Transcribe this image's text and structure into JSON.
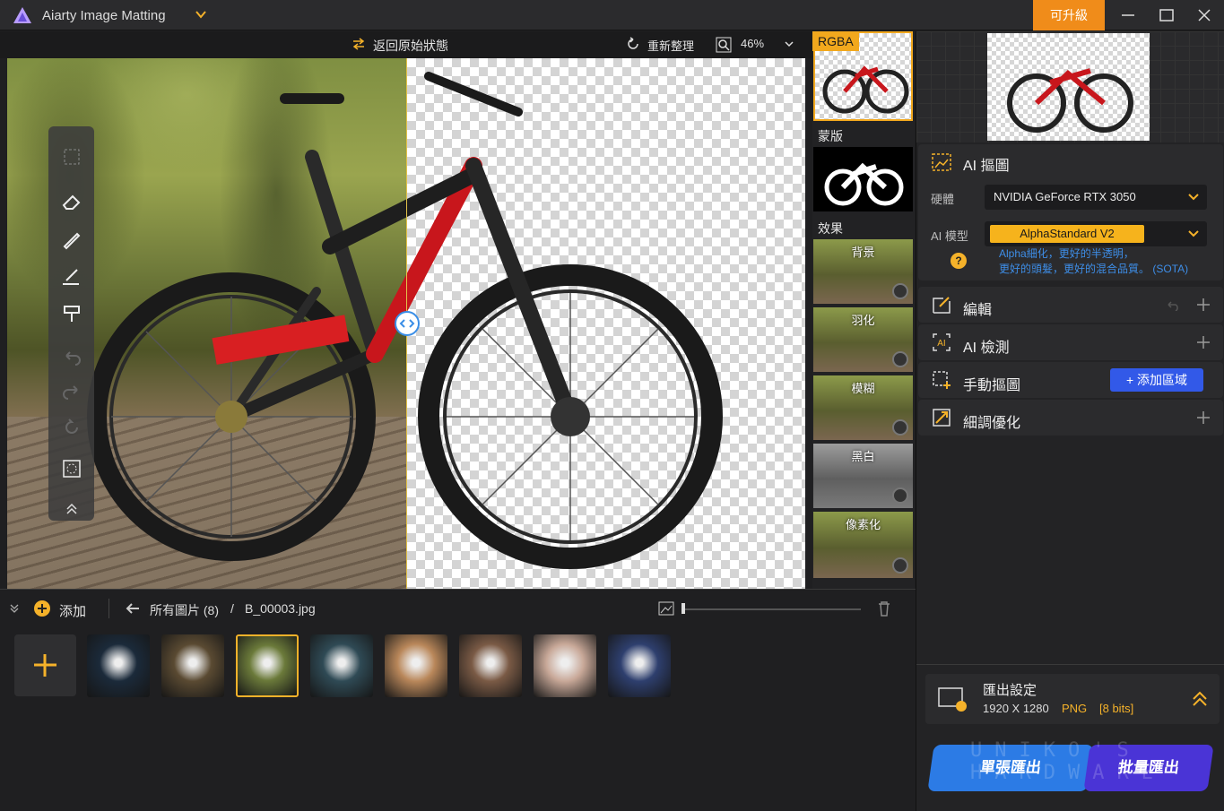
{
  "app": {
    "title": "Aiarty Image Matting",
    "upgrade_label": "可升級"
  },
  "canvas_toolbar": {
    "revert_label": "返回原始狀態",
    "reset_label": "重新整理",
    "zoom": "46%"
  },
  "strip": {
    "rgba_label": "RGBA",
    "mask_label": "蒙版",
    "effects_label": "效果",
    "effects": [
      "背景",
      "羽化",
      "模糊",
      "黑白",
      "像素化"
    ]
  },
  "right_panel": {
    "ai_matting": {
      "title": "AI 摳圖",
      "hardware_label": "硬體",
      "hardware_value": "NVIDIA GeForce RTX 3050",
      "model_label": "AI 模型",
      "model_value": "AlphaStandard  V2",
      "desc_line1": "Alpha細化，更好的半透明，",
      "desc_line2": "更好的頭髮，更好的混合品質。 (SOTA)"
    },
    "edit_title": "編輯",
    "detect_title": "AI 檢測",
    "manual_title": "手動摳圖",
    "add_region_label": "添加區域",
    "refine_title": "細調優化",
    "export": {
      "title": "匯出設定",
      "resolution": "1920 X 1280",
      "format": "PNG",
      "bits": "[8 bits]"
    },
    "single_export_label": "單張匯出",
    "batch_export_label": "批量匯出",
    "watermark": "UNIKO'S HARDWARE"
  },
  "bottom_bar": {
    "add_label": "添加",
    "breadcrumb_all": "所有圖片 (8)",
    "breadcrumb_sep": "/",
    "breadcrumb_file": "B_00003.jpg"
  },
  "thumbnails": [
    {
      "name": "jellyfish",
      "color": "#1b2a3a"
    },
    {
      "name": "forest-rocks",
      "color": "#5a4a32"
    },
    {
      "name": "bicycle",
      "color": "#6b7a3a"
    },
    {
      "name": "woman-red-dress",
      "color": "#2f4a55"
    },
    {
      "name": "woman-flowers",
      "color": "#b9875a"
    },
    {
      "name": "woman-gold",
      "color": "#7a5a45"
    },
    {
      "name": "woman-white",
      "color": "#c8a898"
    },
    {
      "name": "product-box",
      "color": "#2e3f6e"
    }
  ],
  "colors": {
    "accent": "#f5b22a",
    "upgrade": "#f08c1a",
    "primary": "#2c7be5",
    "batch": "#4a34d6"
  }
}
